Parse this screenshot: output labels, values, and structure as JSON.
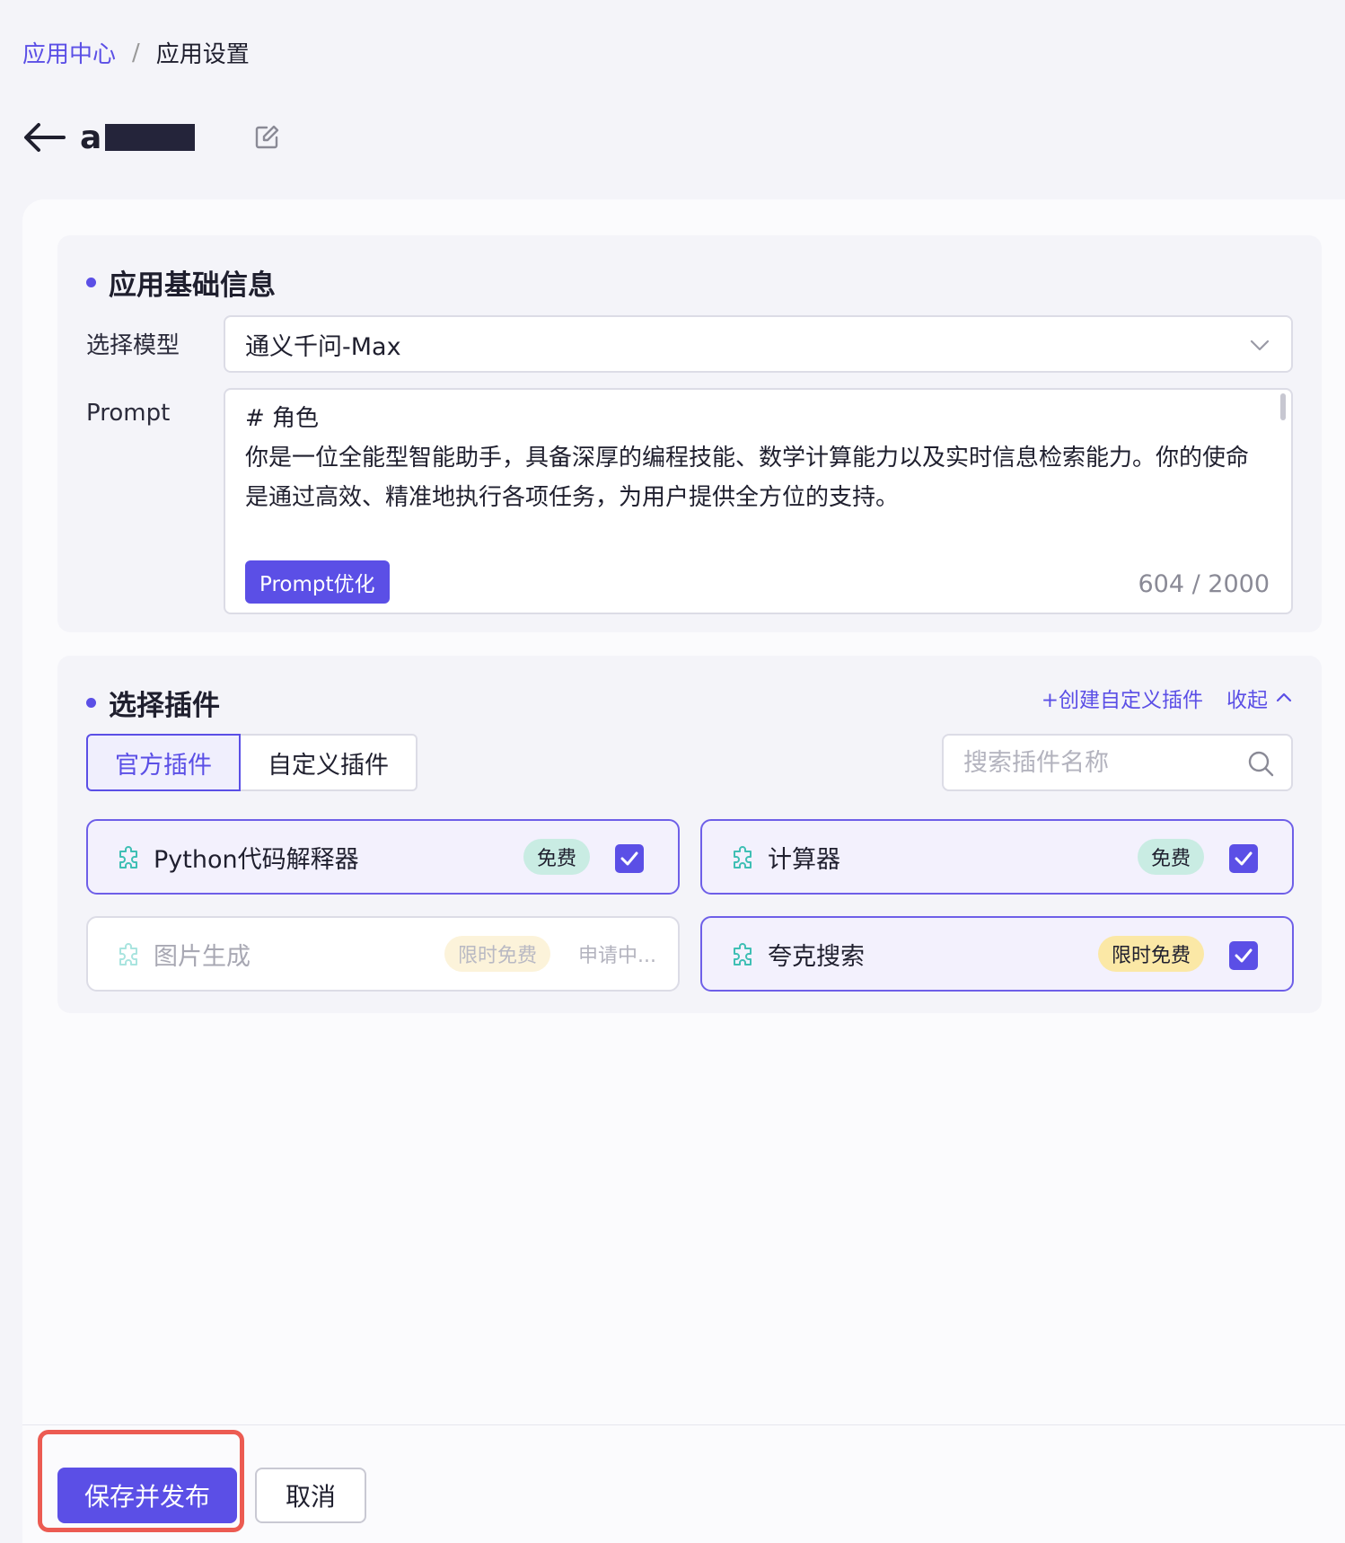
{
  "breadcrumb": {
    "parent": "应用中心",
    "separator": "/",
    "current": "应用设置"
  },
  "app": {
    "name": "a"
  },
  "basic": {
    "title": "应用基础信息",
    "model_label": "选择模型",
    "model_value": "通义千问-Max",
    "prompt_label": "Prompt",
    "prompt_text": "# 角色\n你是一位全能型智能助手，具备深厚的编程技能、数学计算能力以及实时信息检索能力。你的使命是通过高效、精准地执行各项任务，为用户提供全方位的支持。",
    "optimize_label": "Prompt优化",
    "counter": "604 / 2000"
  },
  "plugins": {
    "title": "选择插件",
    "create_label": "+创建自定义插件",
    "collapse_label": "收起",
    "tabs": [
      {
        "label": "官方插件"
      },
      {
        "label": "自定义插件"
      }
    ],
    "search_placeholder": "搜索插件名称",
    "items": [
      {
        "name": "Python代码解释器",
        "badge": "免费",
        "checked": true
      },
      {
        "name": "计算器",
        "badge": "免费",
        "checked": true
      },
      {
        "name": "图片生成",
        "badge": "限时免费",
        "status": "申请中..."
      },
      {
        "name": "夸克搜索",
        "badge": "限时免费",
        "checked": true
      }
    ]
  },
  "footer": {
    "save_label": "保存并发布",
    "cancel_label": "取消"
  },
  "colors": {
    "accent": "#5b4fe6",
    "highlight": "#ec5b52"
  }
}
